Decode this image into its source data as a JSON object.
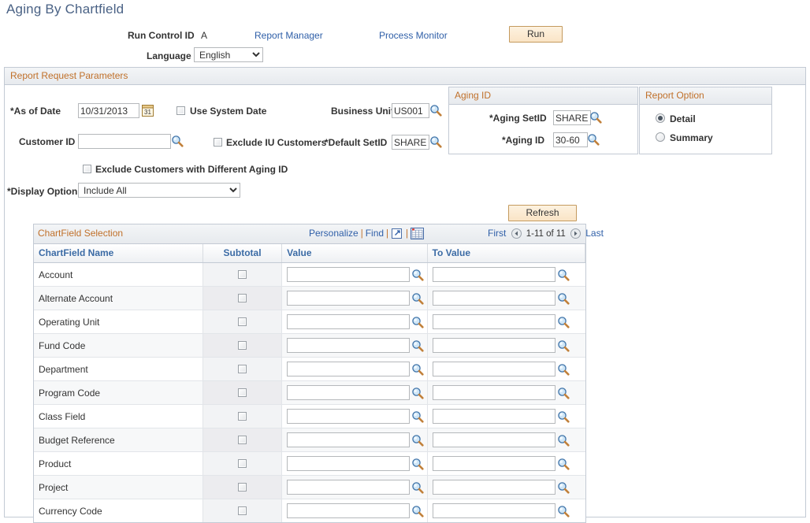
{
  "page": {
    "title": "Aging By Chartfield"
  },
  "run_control": {
    "run_control_id_label": "Run Control ID",
    "run_control_id_value": "A",
    "language_label": "Language",
    "language_value": "English",
    "language_options": [
      "English"
    ],
    "report_manager_link": "Report Manager",
    "process_monitor_link": "Process Monitor",
    "run_button": "Run"
  },
  "params": {
    "header": "Report Request Parameters",
    "as_of_date_label": "*As of Date",
    "as_of_date_value": "10/31/2013",
    "calendar_icon": "calendar-icon",
    "use_system_date_label": "Use System Date",
    "business_unit_label": "Business Unit",
    "business_unit_value": "US001",
    "customer_id_label": "Customer ID",
    "customer_id_value": "",
    "exclude_iu_customers_label": "Exclude IU Customers",
    "default_setid_label": "*Default SetID",
    "default_setid_value": "SHARE",
    "exclude_diff_aging_label": "Exclude Customers with Different Aging ID",
    "display_option_label": "*Display Option",
    "display_option_value": "Include All",
    "display_option_options": [
      "Include All"
    ],
    "refresh_button": "Refresh",
    "lookup_icon": "lookup-magnifier-icon"
  },
  "aging": {
    "header": "Aging ID",
    "setid_label": "*Aging SetID",
    "setid_value": "SHARE",
    "aging_id_label": "*Aging ID",
    "aging_id_value": "30-60"
  },
  "report_option": {
    "header": "Report Option",
    "options": [
      {
        "label": "Detail",
        "selected": true
      },
      {
        "label": "Summary",
        "selected": false
      }
    ]
  },
  "chartfield_grid": {
    "title": "ChartField Selection",
    "personalize_link": "Personalize",
    "find_link": "Find",
    "download_icon": "download-to-excel-icon",
    "view_all_icon": "grid-view-all-icon",
    "first_link": "First",
    "prev_icon": "previous-page-arrow-icon",
    "range_text": "1-11 of 11",
    "next_icon": "next-page-arrow-icon",
    "last_link": "Last",
    "columns": [
      "ChartField Name",
      "Subtotal",
      "Value",
      "To Value"
    ],
    "rows": [
      {
        "name": "Account",
        "subtotal": false,
        "value": "",
        "to_value": ""
      },
      {
        "name": "Alternate Account",
        "subtotal": false,
        "value": "",
        "to_value": ""
      },
      {
        "name": "Operating Unit",
        "subtotal": false,
        "value": "",
        "to_value": ""
      },
      {
        "name": "Fund Code",
        "subtotal": false,
        "value": "",
        "to_value": ""
      },
      {
        "name": "Department",
        "subtotal": false,
        "value": "",
        "to_value": ""
      },
      {
        "name": "Program Code",
        "subtotal": false,
        "value": "",
        "to_value": ""
      },
      {
        "name": "Class Field",
        "subtotal": false,
        "value": "",
        "to_value": ""
      },
      {
        "name": "Budget Reference",
        "subtotal": false,
        "value": "",
        "to_value": ""
      },
      {
        "name": "Product",
        "subtotal": false,
        "value": "",
        "to_value": ""
      },
      {
        "name": "Project",
        "subtotal": false,
        "value": "",
        "to_value": ""
      },
      {
        "name": "Currency Code",
        "subtotal": false,
        "value": "",
        "to_value": ""
      }
    ]
  },
  "colors": {
    "title_blue": "#4a6285",
    "link_blue": "#2f5fa8",
    "group_header_orange": "#c0702a",
    "column_header_blue": "#3b6ba5",
    "button_tan": "#fae4c6"
  }
}
